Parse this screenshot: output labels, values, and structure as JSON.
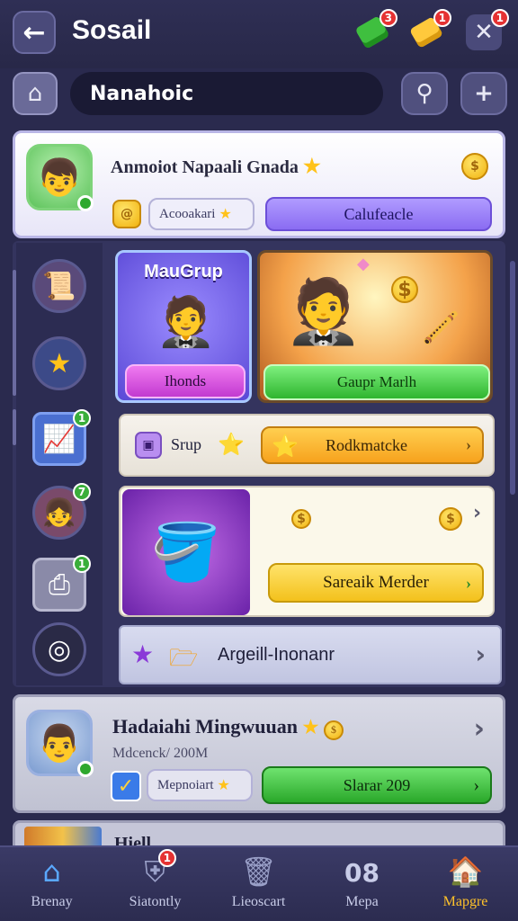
{
  "header": {
    "back_icon": "arrow-left-icon",
    "title": "Sosail",
    "currency_green_badge": "3",
    "currency_yellow_badge": "1",
    "close_badge": "1"
  },
  "search": {
    "value": "Nanahoic"
  },
  "profile": {
    "name": "Anmoiot Napaali Gnada",
    "chip_label": "Acooakari",
    "action_label": "Calufeacle"
  },
  "tiles": {
    "group_title": "MauGrup",
    "group_button": "Ihonds",
    "hero_button": "Gaupr Marlh"
  },
  "group_row": {
    "label": "Srup",
    "button": "Rodkmatcke"
  },
  "reward_row": {
    "button": "Sareaik Merder"
  },
  "arg_row": {
    "label": "Argeill-Inonanr"
  },
  "sidebar": {
    "items": [
      {
        "icon": "map-scroll-icon",
        "badge": ""
      },
      {
        "icon": "star-icon",
        "badge": ""
      },
      {
        "icon": "chart-icon",
        "badge": "1"
      },
      {
        "icon": "player-avatar-icon",
        "badge": "7"
      },
      {
        "icon": "printer-icon",
        "badge": "1"
      },
      {
        "icon": "target-icon",
        "badge": ""
      }
    ]
  },
  "friend": {
    "name": "Hadaiahi Mingwuuan",
    "subtitle": "Mdcenck/ 200M",
    "chip_label": "Mepnoiart",
    "button": "Slarar 209"
  },
  "peek": {
    "text": "Hiell"
  },
  "nav": {
    "items": [
      {
        "label": "Brenay",
        "icon": "home-icon"
      },
      {
        "label": "Siatontly",
        "icon": "shield-icon",
        "badge": "1"
      },
      {
        "label": "Lieoscart",
        "icon": "card-icon"
      },
      {
        "label": "Mepa",
        "icon": "08",
        "icon_is_text": true
      },
      {
        "label": "Mapgre",
        "icon": "house-icon",
        "active": true
      }
    ]
  },
  "colors": {
    "background": "#2a2a4e",
    "accent_purple": "#8a6cf2",
    "accent_green": "#2fb52f",
    "accent_orange": "#f7a21d",
    "accent_yellow": "#ffc22a",
    "badge_red": "#e53232"
  }
}
